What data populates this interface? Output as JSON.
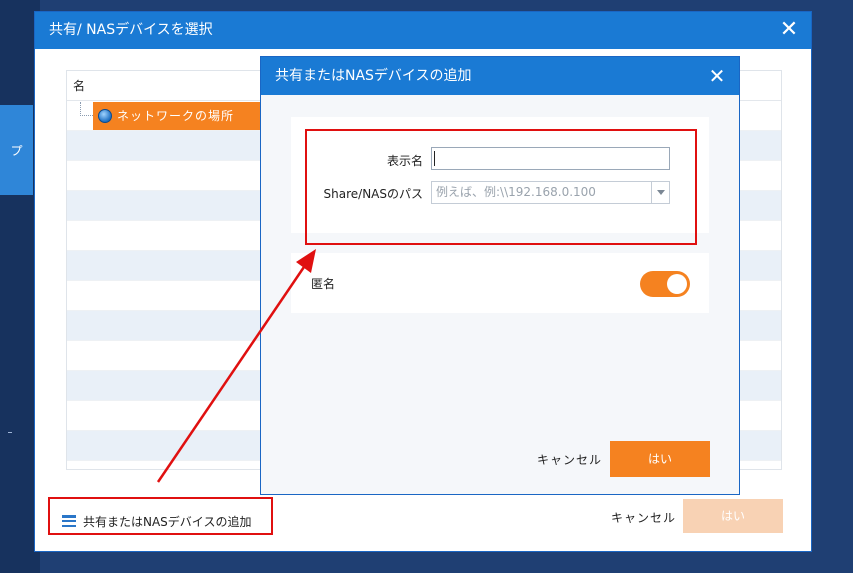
{
  "background": {
    "side_tab_label": "プ"
  },
  "outer_dialog": {
    "title": "共有/ NASデバイスを選択",
    "close_glyph": "✕",
    "tree": {
      "column_header": "名",
      "node_label": "ネットワークの場所"
    },
    "add_link_label": "共有またはNASデバイスの追加",
    "cancel_label": "キャンセル",
    "yes_label": "はい"
  },
  "inner_dialog": {
    "title": "共有またはNASデバイスの追加",
    "close_glyph": "✕",
    "display_name_label": "表示名",
    "display_name_value": "",
    "path_label": "Share/NASのパス",
    "path_placeholder": "例えば、例:\\\\192.168.0.100",
    "anonymous_label": "匿名",
    "anonymous_on": true,
    "cancel_label": "キャンセル",
    "yes_label": "はい"
  },
  "colors": {
    "title_bar": "#1a7ad4",
    "accent_orange": "#f58220",
    "disabled_orange": "#f8d2b4",
    "highlight_red": "#e01010"
  }
}
